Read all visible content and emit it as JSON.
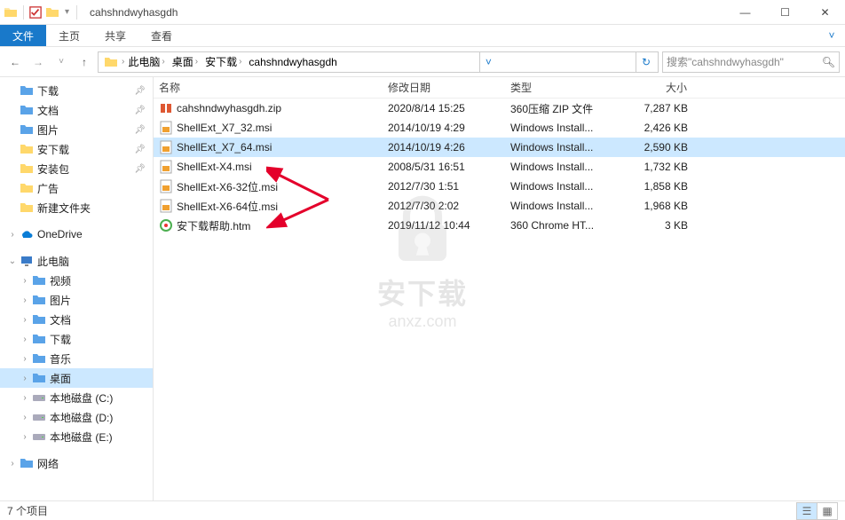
{
  "window": {
    "title": "cahshndwyhasgdh"
  },
  "ribbon": {
    "file": "文件",
    "home": "主页",
    "share": "共享",
    "view": "查看"
  },
  "breadcrumb": [
    "此电脑",
    "桌面",
    "安下载",
    "cahshndwyhasgdh"
  ],
  "search": {
    "placeholder": "搜索\"cahshndwyhasgdh\""
  },
  "sidebar": {
    "quick_items": [
      {
        "label": "下载",
        "icon": "download",
        "pin": true
      },
      {
        "label": "文档",
        "icon": "doc",
        "pin": true
      },
      {
        "label": "图片",
        "icon": "pic",
        "pin": true
      },
      {
        "label": "安下载",
        "icon": "folder",
        "pin": true
      },
      {
        "label": "安装包",
        "icon": "folder",
        "pin": true
      },
      {
        "label": "广告",
        "icon": "folder",
        "pin": false
      },
      {
        "label": "新建文件夹",
        "icon": "folder",
        "pin": false
      }
    ],
    "onedrive": "OneDrive",
    "this_pc": "此电脑",
    "pc_items": [
      {
        "label": "视频",
        "icon": "video"
      },
      {
        "label": "图片",
        "icon": "pic"
      },
      {
        "label": "文档",
        "icon": "doc"
      },
      {
        "label": "下载",
        "icon": "download"
      },
      {
        "label": "音乐",
        "icon": "music"
      },
      {
        "label": "桌面",
        "icon": "desktop",
        "selected": true
      },
      {
        "label": "本地磁盘 (C:)",
        "icon": "disk"
      },
      {
        "label": "本地磁盘 (D:)",
        "icon": "disk"
      },
      {
        "label": "本地磁盘 (E:)",
        "icon": "disk"
      }
    ],
    "network": "网络"
  },
  "columns": {
    "name": "名称",
    "date": "修改日期",
    "type": "类型",
    "size": "大小"
  },
  "files": [
    {
      "name": "cahshndwyhasgdh.zip",
      "date": "2020/8/14 15:25",
      "type": "360压缩 ZIP 文件",
      "size": "7,287 KB",
      "icon": "zip"
    },
    {
      "name": "ShellExt_X7_32.msi",
      "date": "2014/10/19 4:29",
      "type": "Windows Install...",
      "size": "2,426 KB",
      "icon": "msi"
    },
    {
      "name": "ShellExt_X7_64.msi",
      "date": "2014/10/19 4:26",
      "type": "Windows Install...",
      "size": "2,590 KB",
      "icon": "msi",
      "selected": true
    },
    {
      "name": "ShellExt-X4.msi",
      "date": "2008/5/31 16:51",
      "type": "Windows Install...",
      "size": "1,732 KB",
      "icon": "msi"
    },
    {
      "name": "ShellExt-X6-32位.msi",
      "date": "2012/7/30 1:51",
      "type": "Windows Install...",
      "size": "1,858 KB",
      "icon": "msi"
    },
    {
      "name": "ShellExt-X6-64位.msi",
      "date": "2012/7/30 2:02",
      "type": "Windows Install...",
      "size": "1,968 KB",
      "icon": "msi"
    },
    {
      "name": "安下载帮助.htm",
      "date": "2019/11/12 10:44",
      "type": "360 Chrome HT...",
      "size": "3 KB",
      "icon": "htm"
    }
  ],
  "status": {
    "count": "7 个项目"
  },
  "watermark": {
    "line1": "安下载",
    "line2": "anxz.com"
  }
}
